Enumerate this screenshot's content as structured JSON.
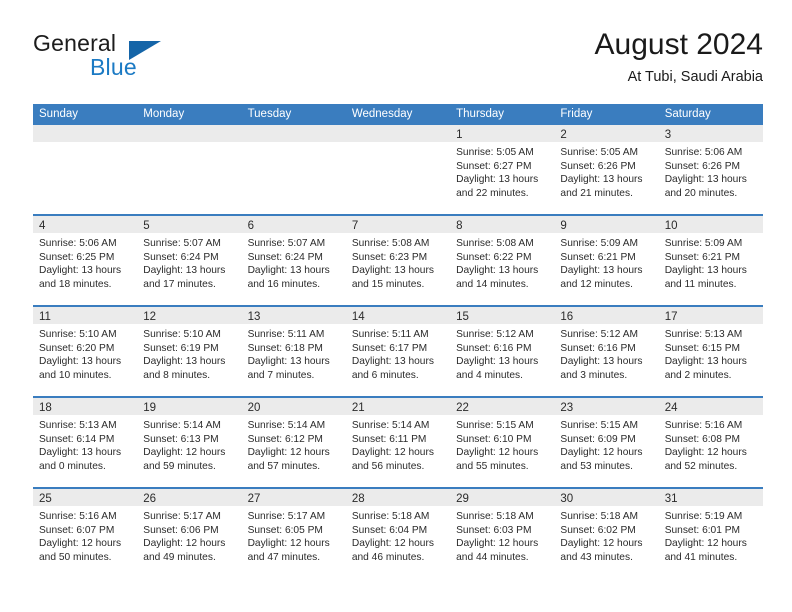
{
  "brand": {
    "word1": "General",
    "word2": "Blue",
    "logo_icon": "triangle-flag-icon",
    "accent_color": "#1b7ac4"
  },
  "header": {
    "title": "August 2024",
    "subtitle": "At Tubi, Saudi Arabia"
  },
  "theme": {
    "header_blue": "#3a7dbf",
    "day_band_gray": "#ebebeb",
    "text_color": "#2b2b2b"
  },
  "calendar": {
    "weekdays": [
      "Sunday",
      "Monday",
      "Tuesday",
      "Wednesday",
      "Thursday",
      "Friday",
      "Saturday"
    ],
    "weeks": [
      [
        {
          "day": "",
          "sunrise": "",
          "sunset": "",
          "daylight": ""
        },
        {
          "day": "",
          "sunrise": "",
          "sunset": "",
          "daylight": ""
        },
        {
          "day": "",
          "sunrise": "",
          "sunset": "",
          "daylight": ""
        },
        {
          "day": "",
          "sunrise": "",
          "sunset": "",
          "daylight": ""
        },
        {
          "day": "1",
          "sunrise": "Sunrise: 5:05 AM",
          "sunset": "Sunset: 6:27 PM",
          "daylight": "Daylight: 13 hours and 22 minutes."
        },
        {
          "day": "2",
          "sunrise": "Sunrise: 5:05 AM",
          "sunset": "Sunset: 6:26 PM",
          "daylight": "Daylight: 13 hours and 21 minutes."
        },
        {
          "day": "3",
          "sunrise": "Sunrise: 5:06 AM",
          "sunset": "Sunset: 6:26 PM",
          "daylight": "Daylight: 13 hours and 20 minutes."
        }
      ],
      [
        {
          "day": "4",
          "sunrise": "Sunrise: 5:06 AM",
          "sunset": "Sunset: 6:25 PM",
          "daylight": "Daylight: 13 hours and 18 minutes."
        },
        {
          "day": "5",
          "sunrise": "Sunrise: 5:07 AM",
          "sunset": "Sunset: 6:24 PM",
          "daylight": "Daylight: 13 hours and 17 minutes."
        },
        {
          "day": "6",
          "sunrise": "Sunrise: 5:07 AM",
          "sunset": "Sunset: 6:24 PM",
          "daylight": "Daylight: 13 hours and 16 minutes."
        },
        {
          "day": "7",
          "sunrise": "Sunrise: 5:08 AM",
          "sunset": "Sunset: 6:23 PM",
          "daylight": "Daylight: 13 hours and 15 minutes."
        },
        {
          "day": "8",
          "sunrise": "Sunrise: 5:08 AM",
          "sunset": "Sunset: 6:22 PM",
          "daylight": "Daylight: 13 hours and 14 minutes."
        },
        {
          "day": "9",
          "sunrise": "Sunrise: 5:09 AM",
          "sunset": "Sunset: 6:21 PM",
          "daylight": "Daylight: 13 hours and 12 minutes."
        },
        {
          "day": "10",
          "sunrise": "Sunrise: 5:09 AM",
          "sunset": "Sunset: 6:21 PM",
          "daylight": "Daylight: 13 hours and 11 minutes."
        }
      ],
      [
        {
          "day": "11",
          "sunrise": "Sunrise: 5:10 AM",
          "sunset": "Sunset: 6:20 PM",
          "daylight": "Daylight: 13 hours and 10 minutes."
        },
        {
          "day": "12",
          "sunrise": "Sunrise: 5:10 AM",
          "sunset": "Sunset: 6:19 PM",
          "daylight": "Daylight: 13 hours and 8 minutes."
        },
        {
          "day": "13",
          "sunrise": "Sunrise: 5:11 AM",
          "sunset": "Sunset: 6:18 PM",
          "daylight": "Daylight: 13 hours and 7 minutes."
        },
        {
          "day": "14",
          "sunrise": "Sunrise: 5:11 AM",
          "sunset": "Sunset: 6:17 PM",
          "daylight": "Daylight: 13 hours and 6 minutes."
        },
        {
          "day": "15",
          "sunrise": "Sunrise: 5:12 AM",
          "sunset": "Sunset: 6:16 PM",
          "daylight": "Daylight: 13 hours and 4 minutes."
        },
        {
          "day": "16",
          "sunrise": "Sunrise: 5:12 AM",
          "sunset": "Sunset: 6:16 PM",
          "daylight": "Daylight: 13 hours and 3 minutes."
        },
        {
          "day": "17",
          "sunrise": "Sunrise: 5:13 AM",
          "sunset": "Sunset: 6:15 PM",
          "daylight": "Daylight: 13 hours and 2 minutes."
        }
      ],
      [
        {
          "day": "18",
          "sunrise": "Sunrise: 5:13 AM",
          "sunset": "Sunset: 6:14 PM",
          "daylight": "Daylight: 13 hours and 0 minutes."
        },
        {
          "day": "19",
          "sunrise": "Sunrise: 5:14 AM",
          "sunset": "Sunset: 6:13 PM",
          "daylight": "Daylight: 12 hours and 59 minutes."
        },
        {
          "day": "20",
          "sunrise": "Sunrise: 5:14 AM",
          "sunset": "Sunset: 6:12 PM",
          "daylight": "Daylight: 12 hours and 57 minutes."
        },
        {
          "day": "21",
          "sunrise": "Sunrise: 5:14 AM",
          "sunset": "Sunset: 6:11 PM",
          "daylight": "Daylight: 12 hours and 56 minutes."
        },
        {
          "day": "22",
          "sunrise": "Sunrise: 5:15 AM",
          "sunset": "Sunset: 6:10 PM",
          "daylight": "Daylight: 12 hours and 55 minutes."
        },
        {
          "day": "23",
          "sunrise": "Sunrise: 5:15 AM",
          "sunset": "Sunset: 6:09 PM",
          "daylight": "Daylight: 12 hours and 53 minutes."
        },
        {
          "day": "24",
          "sunrise": "Sunrise: 5:16 AM",
          "sunset": "Sunset: 6:08 PM",
          "daylight": "Daylight: 12 hours and 52 minutes."
        }
      ],
      [
        {
          "day": "25",
          "sunrise": "Sunrise: 5:16 AM",
          "sunset": "Sunset: 6:07 PM",
          "daylight": "Daylight: 12 hours and 50 minutes."
        },
        {
          "day": "26",
          "sunrise": "Sunrise: 5:17 AM",
          "sunset": "Sunset: 6:06 PM",
          "daylight": "Daylight: 12 hours and 49 minutes."
        },
        {
          "day": "27",
          "sunrise": "Sunrise: 5:17 AM",
          "sunset": "Sunset: 6:05 PM",
          "daylight": "Daylight: 12 hours and 47 minutes."
        },
        {
          "day": "28",
          "sunrise": "Sunrise: 5:18 AM",
          "sunset": "Sunset: 6:04 PM",
          "daylight": "Daylight: 12 hours and 46 minutes."
        },
        {
          "day": "29",
          "sunrise": "Sunrise: 5:18 AM",
          "sunset": "Sunset: 6:03 PM",
          "daylight": "Daylight: 12 hours and 44 minutes."
        },
        {
          "day": "30",
          "sunrise": "Sunrise: 5:18 AM",
          "sunset": "Sunset: 6:02 PM",
          "daylight": "Daylight: 12 hours and 43 minutes."
        },
        {
          "day": "31",
          "sunrise": "Sunrise: 5:19 AM",
          "sunset": "Sunset: 6:01 PM",
          "daylight": "Daylight: 12 hours and 41 minutes."
        }
      ]
    ]
  }
}
